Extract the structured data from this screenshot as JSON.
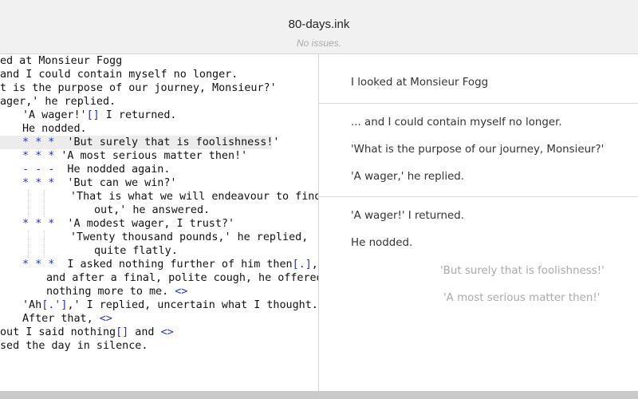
{
  "window": {
    "title": "80-days.ink",
    "status": "No issues."
  },
  "editor": {
    "lines": [
      {
        "segments": [
          {
            "t": "ed at Monsieur Fogg",
            "c": "text"
          }
        ]
      },
      {
        "segments": [
          {
            "t": "and I could contain myself no longer.",
            "c": "text"
          }
        ]
      },
      {
        "segments": [
          {
            "t": "t is the purpose of our journey, Monsieur?'",
            "c": "text"
          }
        ]
      },
      {
        "segments": [
          {
            "t": "ager,' he replied.",
            "c": "text"
          }
        ]
      },
      {
        "segments": [
          {
            "t": "'A wager!'",
            "c": "text"
          },
          {
            "t": "[]",
            "c": "mk"
          },
          {
            "t": " I returned.",
            "c": "text"
          }
        ]
      },
      {
        "segments": [
          {
            "t": "He nodded.",
            "c": "text"
          }
        ]
      },
      {
        "segments": [
          {
            "t": "* * *",
            "c": "mk"
          },
          {
            "t": "  'But surely that is foolishness!'",
            "c": "text"
          }
        ]
      },
      {
        "segments": [
          {
            "t": "* * *",
            "c": "mk"
          },
          {
            "t": " 'A most serious matter then!'",
            "c": "text"
          }
        ]
      },
      {
        "segments": [
          {
            "t": "- - -",
            "c": "mk"
          },
          {
            "t": "  He nodded again.",
            "c": "text"
          }
        ]
      },
      {
        "segments": [
          {
            "t": "* * *",
            "c": "mk"
          },
          {
            "t": "  'But can we win?'",
            "c": "text"
          }
        ]
      },
      {
        "segments": [
          {
            "t": "'That is what we will endeavour to find",
            "c": "text"
          }
        ]
      },
      {
        "segments": [
          {
            "t": "out,' he answered.",
            "c": "text"
          }
        ]
      },
      {
        "segments": [
          {
            "t": "* * *",
            "c": "mk"
          },
          {
            "t": "  'A modest wager, I trust?'",
            "c": "text"
          }
        ]
      },
      {
        "segments": [
          {
            "t": "'Twenty thousand pounds,' he replied,",
            "c": "text"
          }
        ]
      },
      {
        "segments": [
          {
            "t": "quite flatly.",
            "c": "text"
          }
        ]
      },
      {
        "segments": [
          {
            "t": "* * *",
            "c": "mk"
          },
          {
            "t": "  I asked nothing further of him then",
            "c": "text"
          },
          {
            "t": "[.]",
            "c": "mk"
          },
          {
            "t": ",",
            "c": "text"
          }
        ]
      },
      {
        "segments": [
          {
            "t": "and after a final, polite cough, he offered",
            "c": "text"
          }
        ]
      },
      {
        "segments": [
          {
            "t": "nothing more to me. ",
            "c": "text"
          },
          {
            "t": "<>",
            "c": "mk"
          }
        ]
      },
      {
        "segments": [
          {
            "t": "'Ah",
            "c": "text"
          },
          {
            "t": "[.']",
            "c": "mk"
          },
          {
            "t": ",' I replied, uncertain what I thought.",
            "c": "text"
          }
        ]
      },
      {
        "segments": [
          {
            "t": "After that, ",
            "c": "text"
          },
          {
            "t": "<>",
            "c": "mk"
          }
        ]
      },
      {
        "segments": [
          {
            "t": "out I said nothing",
            "c": "text"
          },
          {
            "t": "[]",
            "c": "mk"
          },
          {
            "t": " and ",
            "c": "text"
          },
          {
            "t": "<>",
            "c": "mk"
          }
        ]
      },
      {
        "segments": [
          {
            "t": "sed the day in silence.",
            "c": "text"
          }
        ]
      }
    ]
  },
  "preview": {
    "section1": [
      "I looked at Monsieur Fogg"
    ],
    "section2": [
      "... and I could contain myself no longer.",
      "'What is the purpose of our journey, Monsieur?'",
      "'A wager,' he replied."
    ],
    "section3": [
      "'A wager!' I returned.",
      "He nodded."
    ],
    "choices": [
      "'But surely that is foolishness!'",
      "'A most serious matter then!'"
    ]
  },
  "colors": {
    "markup": "#2233cc",
    "choice_text": "#aaaaaa",
    "active_line": "#ececec"
  }
}
